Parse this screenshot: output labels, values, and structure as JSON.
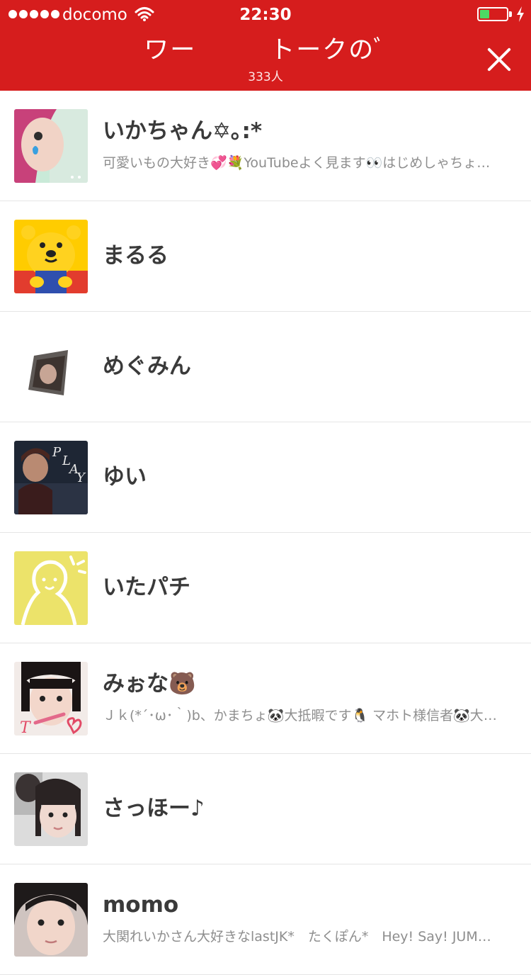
{
  "status_bar": {
    "carrier": "docomo",
    "time": "22:30",
    "battery_level": 0.35,
    "battery_color": "#4cd964"
  },
  "header": {
    "title_left": "ワー",
    "title_right": "トークのﾞ",
    "member_count": "333人",
    "background_color": "#d61d1d"
  },
  "members": [
    {
      "name": "いかちゃん✡｡:*",
      "message": "可愛いもの大好き💞💐YouTubeよく見ます👀はじめしゃちょーさん大好き"
    },
    {
      "name": "まるる",
      "message": ""
    },
    {
      "name": "めぐみん",
      "message": ""
    },
    {
      "name": "ゆい",
      "message": ""
    },
    {
      "name": "いたパチ",
      "message": ""
    },
    {
      "name": "みぉな🐻",
      "message": "Ｊｋ(*´･ω･｀)b、かまちょ🐼大抵暇です🐧 マホト様信者🐼大好き"
    },
    {
      "name": "さっほー♪",
      "message": ""
    },
    {
      "name": "momo",
      "message": "大関れいかさん大好きなlastJK*　たくぽん*　Hey! Say! JUMP大好き"
    }
  ]
}
